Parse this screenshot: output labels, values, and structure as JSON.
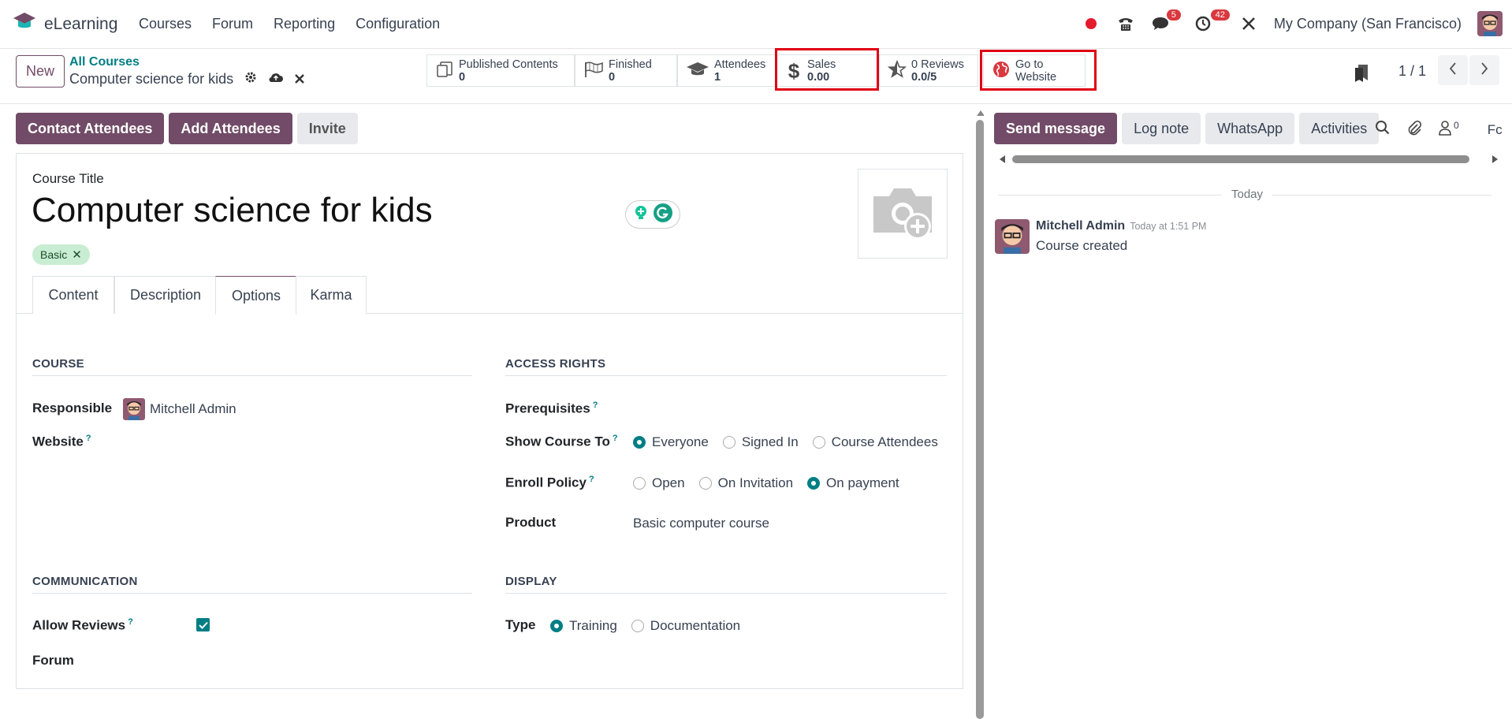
{
  "nav": {
    "app_name": "eLearning",
    "menu": [
      "Courses",
      "Forum",
      "Reporting",
      "Configuration"
    ],
    "messages_count": "5",
    "activities_count": "42",
    "company": "My Company (San Francisco)"
  },
  "control": {
    "new_label": "New",
    "breadcrumb_parent": "All Courses",
    "breadcrumb_current": "Computer science for kids",
    "pager": "1 / 1"
  },
  "stats": {
    "published_label": "Published Contents",
    "published_value": "0",
    "finished_label": "Finished",
    "finished_value": "0",
    "attendees_label": "Attendees",
    "attendees_value": "1",
    "sales_label": "Sales",
    "sales_value": "0.00",
    "reviews_label": "0 Reviews",
    "reviews_value": "0.0/5",
    "website_label_1": "Go to",
    "website_label_2": "Website"
  },
  "actions": {
    "contact": "Contact Attendees",
    "add": "Add Attendees",
    "invite": "Invite"
  },
  "form": {
    "title_label": "Course Title",
    "title": "Computer science for kids",
    "tag": "Basic",
    "tabs": [
      "Content",
      "Description",
      "Options",
      "Karma"
    ],
    "course_section": "COURSE",
    "responsible_label": "Responsible",
    "responsible_value": "Mitchell Admin",
    "website_label": "Website",
    "access_section": "ACCESS RIGHTS",
    "prerequisites_label": "Prerequisites",
    "show_course_label": "Show Course To",
    "show_options": [
      "Everyone",
      "Signed In",
      "Course Attendees"
    ],
    "enroll_label": "Enroll Policy",
    "enroll_options": [
      "Open",
      "On Invitation",
      "On payment"
    ],
    "product_label": "Product",
    "product_value": "Basic computer course",
    "communication_section": "COMMUNICATION",
    "allow_reviews_label": "Allow Reviews",
    "forum_label": "Forum",
    "display_section": "DISPLAY",
    "type_label": "Type",
    "type_options": [
      "Training",
      "Documentation"
    ],
    "help_mark": "?"
  },
  "chatter": {
    "send_message": "Send message",
    "log_note": "Log note",
    "whatsapp": "WhatsApp",
    "activities": "Activities",
    "followers": "0",
    "follow_clip": "Fc",
    "today": "Today",
    "author": "Mitchell Admin",
    "time": "Today at 1:51 PM",
    "message": "Course created"
  },
  "colors": {
    "brand": "#714B67",
    "teal": "#017e84",
    "highlight": "#e00014"
  }
}
